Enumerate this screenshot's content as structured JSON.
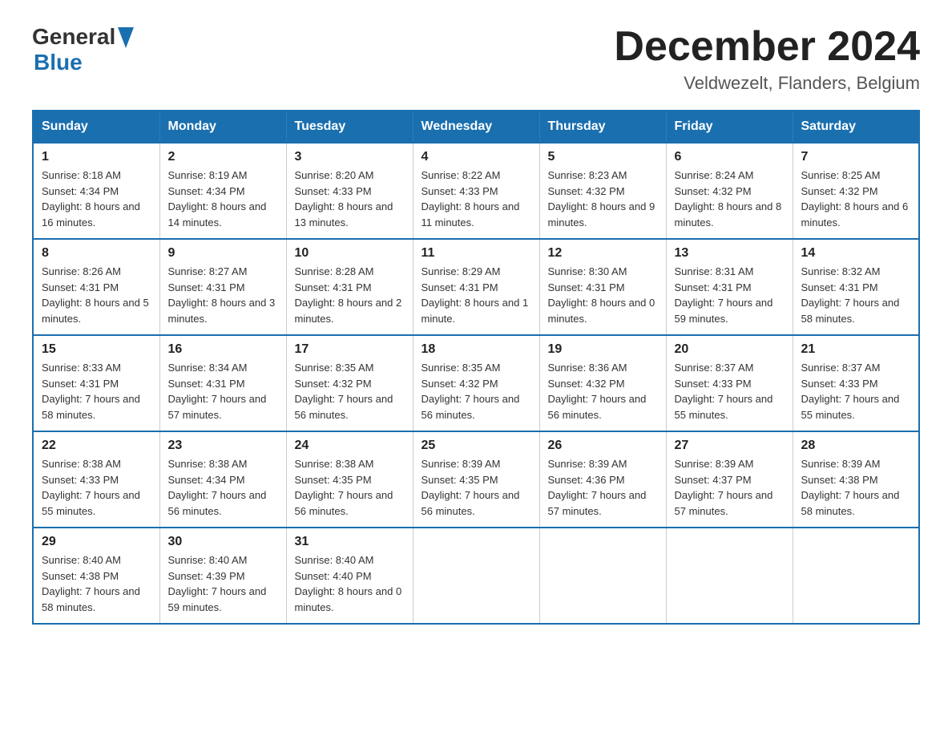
{
  "header": {
    "logo_general": "General",
    "logo_blue": "Blue",
    "month_title": "December 2024",
    "location": "Veldwezelt, Flanders, Belgium"
  },
  "days_of_week": [
    "Sunday",
    "Monday",
    "Tuesday",
    "Wednesday",
    "Thursday",
    "Friday",
    "Saturday"
  ],
  "weeks": [
    [
      {
        "day": "1",
        "sunrise": "8:18 AM",
        "sunset": "4:34 PM",
        "daylight": "8 hours and 16 minutes."
      },
      {
        "day": "2",
        "sunrise": "8:19 AM",
        "sunset": "4:34 PM",
        "daylight": "8 hours and 14 minutes."
      },
      {
        "day": "3",
        "sunrise": "8:20 AM",
        "sunset": "4:33 PM",
        "daylight": "8 hours and 13 minutes."
      },
      {
        "day": "4",
        "sunrise": "8:22 AM",
        "sunset": "4:33 PM",
        "daylight": "8 hours and 11 minutes."
      },
      {
        "day": "5",
        "sunrise": "8:23 AM",
        "sunset": "4:32 PM",
        "daylight": "8 hours and 9 minutes."
      },
      {
        "day": "6",
        "sunrise": "8:24 AM",
        "sunset": "4:32 PM",
        "daylight": "8 hours and 8 minutes."
      },
      {
        "day": "7",
        "sunrise": "8:25 AM",
        "sunset": "4:32 PM",
        "daylight": "8 hours and 6 minutes."
      }
    ],
    [
      {
        "day": "8",
        "sunrise": "8:26 AM",
        "sunset": "4:31 PM",
        "daylight": "8 hours and 5 minutes."
      },
      {
        "day": "9",
        "sunrise": "8:27 AM",
        "sunset": "4:31 PM",
        "daylight": "8 hours and 3 minutes."
      },
      {
        "day": "10",
        "sunrise": "8:28 AM",
        "sunset": "4:31 PM",
        "daylight": "8 hours and 2 minutes."
      },
      {
        "day": "11",
        "sunrise": "8:29 AM",
        "sunset": "4:31 PM",
        "daylight": "8 hours and 1 minute."
      },
      {
        "day": "12",
        "sunrise": "8:30 AM",
        "sunset": "4:31 PM",
        "daylight": "8 hours and 0 minutes."
      },
      {
        "day": "13",
        "sunrise": "8:31 AM",
        "sunset": "4:31 PM",
        "daylight": "7 hours and 59 minutes."
      },
      {
        "day": "14",
        "sunrise": "8:32 AM",
        "sunset": "4:31 PM",
        "daylight": "7 hours and 58 minutes."
      }
    ],
    [
      {
        "day": "15",
        "sunrise": "8:33 AM",
        "sunset": "4:31 PM",
        "daylight": "7 hours and 58 minutes."
      },
      {
        "day": "16",
        "sunrise": "8:34 AM",
        "sunset": "4:31 PM",
        "daylight": "7 hours and 57 minutes."
      },
      {
        "day": "17",
        "sunrise": "8:35 AM",
        "sunset": "4:32 PM",
        "daylight": "7 hours and 56 minutes."
      },
      {
        "day": "18",
        "sunrise": "8:35 AM",
        "sunset": "4:32 PM",
        "daylight": "7 hours and 56 minutes."
      },
      {
        "day": "19",
        "sunrise": "8:36 AM",
        "sunset": "4:32 PM",
        "daylight": "7 hours and 56 minutes."
      },
      {
        "day": "20",
        "sunrise": "8:37 AM",
        "sunset": "4:33 PM",
        "daylight": "7 hours and 55 minutes."
      },
      {
        "day": "21",
        "sunrise": "8:37 AM",
        "sunset": "4:33 PM",
        "daylight": "7 hours and 55 minutes."
      }
    ],
    [
      {
        "day": "22",
        "sunrise": "8:38 AM",
        "sunset": "4:33 PM",
        "daylight": "7 hours and 55 minutes."
      },
      {
        "day": "23",
        "sunrise": "8:38 AM",
        "sunset": "4:34 PM",
        "daylight": "7 hours and 56 minutes."
      },
      {
        "day": "24",
        "sunrise": "8:38 AM",
        "sunset": "4:35 PM",
        "daylight": "7 hours and 56 minutes."
      },
      {
        "day": "25",
        "sunrise": "8:39 AM",
        "sunset": "4:35 PM",
        "daylight": "7 hours and 56 minutes."
      },
      {
        "day": "26",
        "sunrise": "8:39 AM",
        "sunset": "4:36 PM",
        "daylight": "7 hours and 57 minutes."
      },
      {
        "day": "27",
        "sunrise": "8:39 AM",
        "sunset": "4:37 PM",
        "daylight": "7 hours and 57 minutes."
      },
      {
        "day": "28",
        "sunrise": "8:39 AM",
        "sunset": "4:38 PM",
        "daylight": "7 hours and 58 minutes."
      }
    ],
    [
      {
        "day": "29",
        "sunrise": "8:40 AM",
        "sunset": "4:38 PM",
        "daylight": "7 hours and 58 minutes."
      },
      {
        "day": "30",
        "sunrise": "8:40 AM",
        "sunset": "4:39 PM",
        "daylight": "7 hours and 59 minutes."
      },
      {
        "day": "31",
        "sunrise": "8:40 AM",
        "sunset": "4:40 PM",
        "daylight": "8 hours and 0 minutes."
      },
      null,
      null,
      null,
      null
    ]
  ]
}
